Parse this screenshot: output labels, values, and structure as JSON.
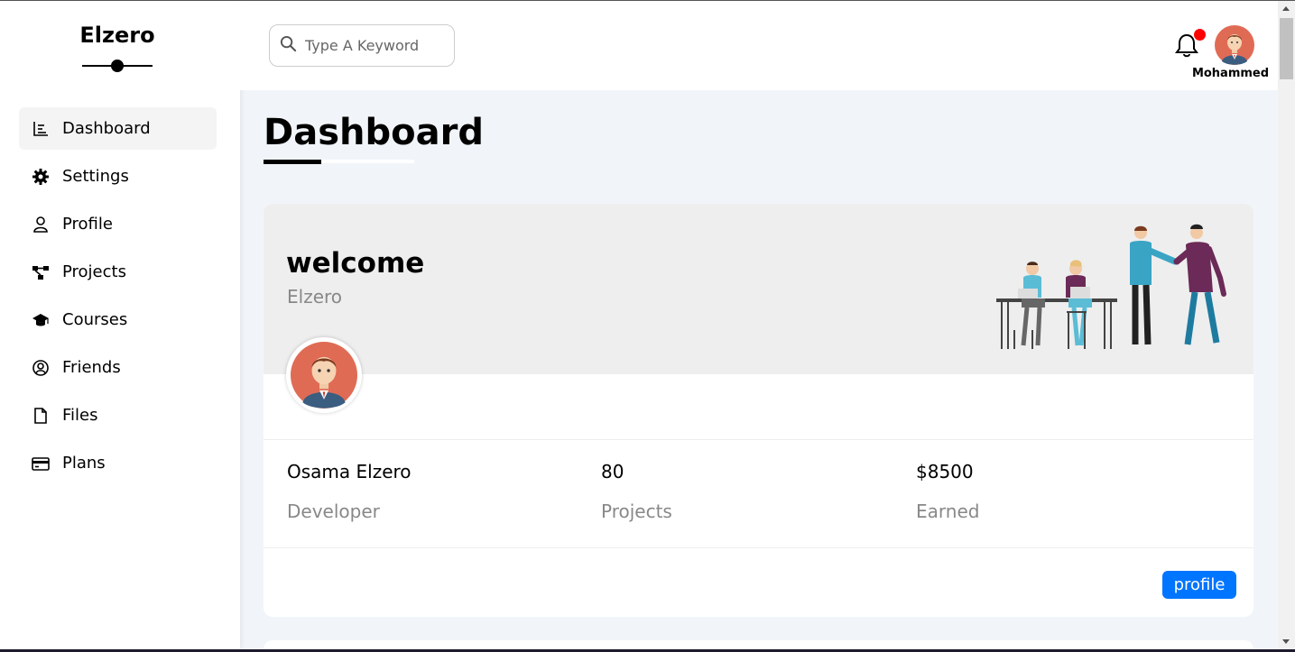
{
  "sidebar": {
    "brand": "Elzero",
    "items": [
      {
        "label": "Dashboard",
        "icon": "chart-bar-icon",
        "active": true
      },
      {
        "label": "Settings",
        "icon": "gear-icon",
        "active": false
      },
      {
        "label": "Profile",
        "icon": "user-icon",
        "active": false
      },
      {
        "label": "Projects",
        "icon": "diagram-project-icon",
        "active": false
      },
      {
        "label": "Courses",
        "icon": "graduation-cap-icon",
        "active": false
      },
      {
        "label": "Friends",
        "icon": "user-circle-icon",
        "active": false
      },
      {
        "label": "Files",
        "icon": "file-icon",
        "active": false
      },
      {
        "label": "Plans",
        "icon": "credit-card-icon",
        "active": false
      }
    ]
  },
  "header": {
    "search_placeholder": "Type A Keyword",
    "user_name": "Mohammed",
    "notification_dot_color": "#ff0000"
  },
  "main": {
    "title": "Dashboard",
    "welcome_card": {
      "heading": "welcome",
      "subheading": "Elzero",
      "stats": [
        {
          "value": "Osama Elzero",
          "label": "Developer"
        },
        {
          "value": "80",
          "label": "Projects"
        },
        {
          "value": "$8500",
          "label": "Earned"
        }
      ],
      "button_label": "profile"
    }
  },
  "colors": {
    "accent": "#0075ff",
    "background": "#f1f5f9",
    "card_header": "#eeeeee",
    "muted_text": "#888888"
  }
}
